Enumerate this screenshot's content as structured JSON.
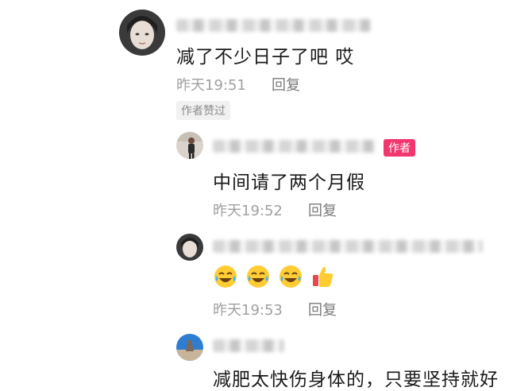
{
  "comments": [
    {
      "text": "减了不少日子了吧 哎",
      "time": "昨天19:51",
      "reply_label": "回复",
      "liked_badge": "作者赞过"
    },
    {
      "text": "中间请了两个月假",
      "time": "昨天19:52",
      "reply_label": "回复",
      "author_badge": "作者"
    },
    {
      "emoji_icons": [
        "tears-of-joy-icon",
        "tears-of-joy-icon",
        "tears-of-joy-icon",
        "thumbs-up-icon"
      ],
      "time": "昨天19:53",
      "reply_label": "回复"
    },
    {
      "text": "减肥太快伤身体的，只要坚持就好"
    }
  ],
  "colors": {
    "author_badge_bg": "#f2366e",
    "meta_gray": "#a0a0a0",
    "text_dark": "#1a1a1a"
  }
}
